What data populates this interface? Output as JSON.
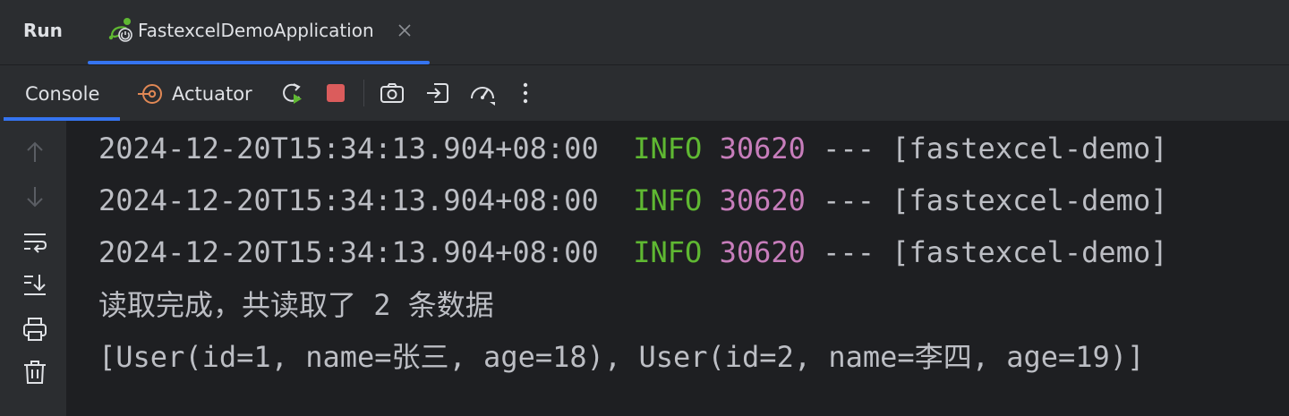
{
  "header": {
    "run_label": "Run",
    "app_tab_label": "FastexcelDemoApplication"
  },
  "toolbar": {
    "tabs": [
      {
        "label": "Console"
      },
      {
        "label": "Actuator"
      }
    ],
    "buttons": [
      {
        "icon": "rerun-icon"
      },
      {
        "icon": "stop-icon"
      },
      {
        "icon": "screenshot-camera-icon"
      },
      {
        "icon": "exit-icon"
      },
      {
        "icon": "profiler-gauge-icon"
      },
      {
        "icon": "more-options-icon"
      }
    ]
  },
  "gutter": {
    "buttons": [
      {
        "icon": "up-arrow-icon"
      },
      {
        "icon": "down-arrow-icon"
      },
      {
        "icon": "soft-wrap-icon"
      },
      {
        "icon": "scroll-to-end-icon"
      },
      {
        "icon": "print-icon"
      },
      {
        "icon": "clear-trash-icon"
      }
    ]
  },
  "console": {
    "log_lines": [
      {
        "timestamp": "2024-12-20T15:34:13.904+08:00",
        "level": "INFO",
        "pid": "30620",
        "separator": "---",
        "thread": "[fastexcel-demo]"
      },
      {
        "timestamp": "2024-12-20T15:34:13.904+08:00",
        "level": "INFO",
        "pid": "30620",
        "separator": "---",
        "thread": "[fastexcel-demo]"
      },
      {
        "timestamp": "2024-12-20T15:34:13.904+08:00",
        "level": "INFO",
        "pid": "30620",
        "separator": "---",
        "thread": "[fastexcel-demo]"
      }
    ],
    "plain_lines": [
      "读取完成，共读取了 2 条数据",
      "[User(id=1, name=张三, age=18), User(id=2, name=李四, age=19)]"
    ]
  },
  "colors": {
    "background": "#1e1f22",
    "panel": "#2b2d30",
    "accent": "#3574f0",
    "info_level": "#5fb832",
    "pid": "#c77dbb",
    "text": "#bcbec4"
  }
}
